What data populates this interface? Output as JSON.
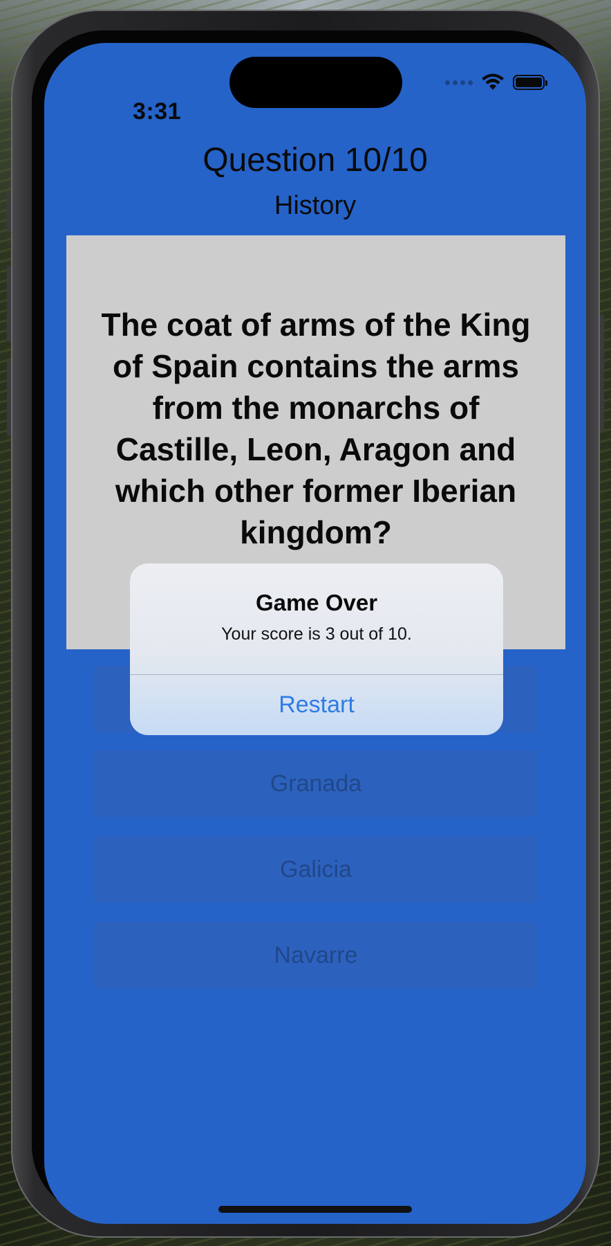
{
  "status_bar": {
    "time": "3:31",
    "icons": [
      "cellular-signal-icon",
      "wifi-icon",
      "battery-icon"
    ]
  },
  "header": {
    "title": "Question 10/10",
    "category": "History"
  },
  "question": {
    "text": "The coat of arms of the King of Spain contains the arms from the monarchs of Castille, Leon, Aragon and which other former Iberian kingdom?"
  },
  "answers": [
    {
      "label": ""
    },
    {
      "label": "Granada"
    },
    {
      "label": "Galicia"
    },
    {
      "label": "Navarre"
    }
  ],
  "alert": {
    "title": "Game Over",
    "message": "Your score is 3 out of 10.",
    "button_label": "Restart"
  },
  "colors": {
    "screen_background": "#2563c9",
    "card_background": "#cdcdcd",
    "alert_button": "#2f7be5"
  }
}
